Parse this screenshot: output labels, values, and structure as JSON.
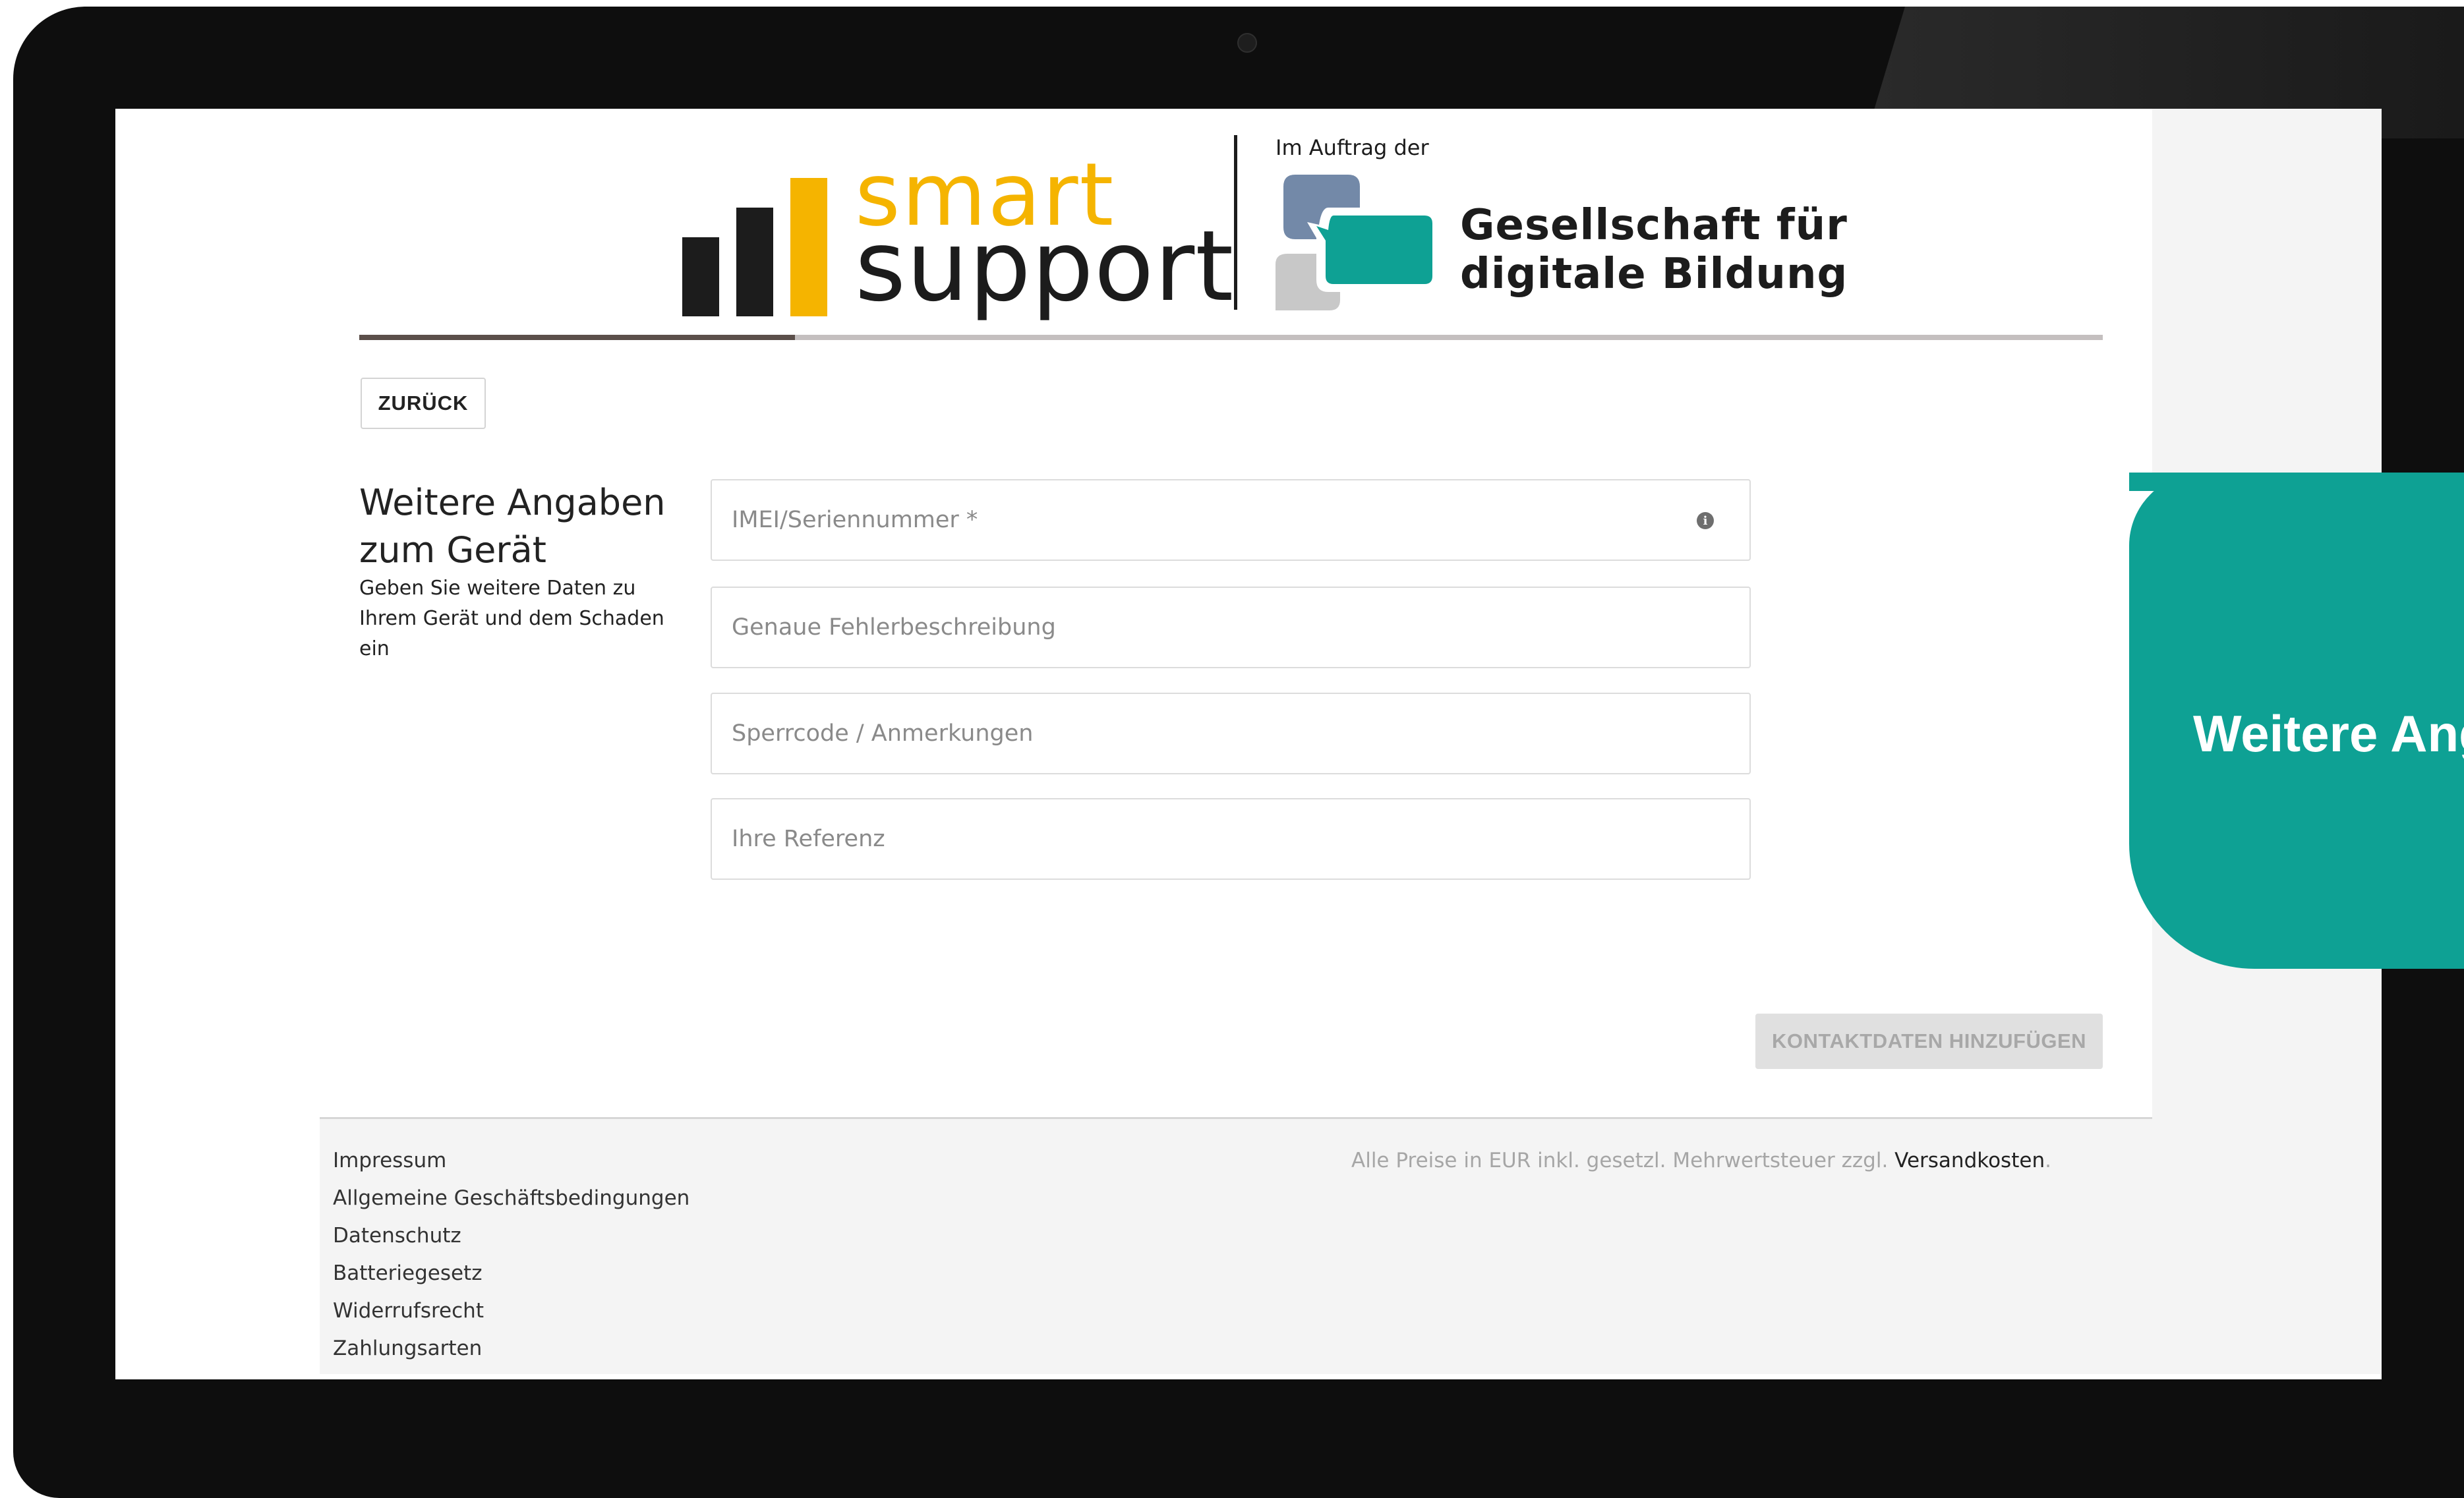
{
  "header": {
    "logo_smart": "smart",
    "logo_support": "support",
    "auftrag": "Im Auftrag der",
    "partner_line1": "Gesellschaft für",
    "partner_line2": "digitale Bildung",
    "brand_yellow": "#f5b400",
    "brand_teal": "#0ea194",
    "brand_blue_gray": "#7389a8",
    "brand_light_gray": "#c8c8c8"
  },
  "progress": {
    "fraction": 0.25
  },
  "nav": {
    "back_label": "ZURÜCK"
  },
  "section": {
    "title": "Weitere Angaben zum Gerät",
    "subtitle": "Geben Sie weitere Daten zu Ihrem Gerät und dem Schaden ein"
  },
  "fields": {
    "imei": {
      "placeholder": "IMEI/Seriennummer *",
      "value": "",
      "icon": "info-icon"
    },
    "fehler": {
      "placeholder": "Genaue Fehlerbeschreibung",
      "value": ""
    },
    "sperrcode": {
      "placeholder": "Sperrcode / Anmerkungen",
      "value": ""
    },
    "referenz": {
      "placeholder": "Ihre Referenz",
      "value": ""
    }
  },
  "actions": {
    "submit_label": "KONTAKTDATEN HINZUFÜGEN"
  },
  "footer": {
    "links": [
      "Impressum",
      "Allgemeine Geschäftsbedingungen",
      "Datenschutz",
      "Batteriegesetz",
      "Widerrufsrecht",
      "Zahlungsarten"
    ],
    "price_note": "Alle Preise in EUR inkl. gesetzl. Mehrwertsteuer zzgl. ",
    "shipping_link": "Versandkosten",
    "trailing": "."
  },
  "badge": {
    "label": "Weitere Ang"
  }
}
